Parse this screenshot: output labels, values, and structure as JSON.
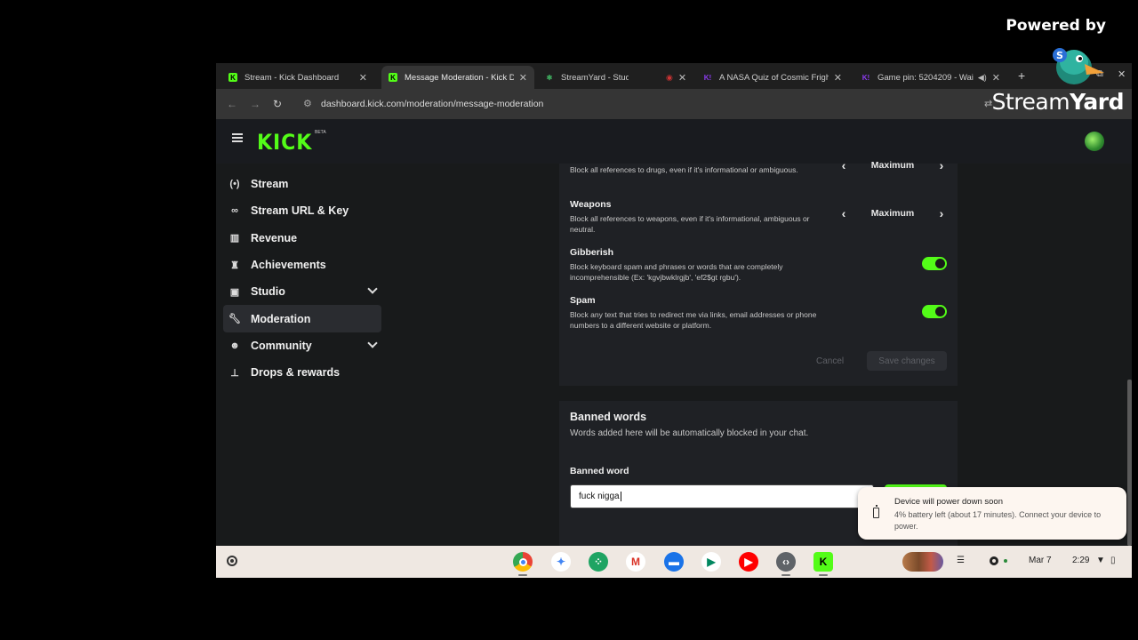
{
  "overlay": {
    "powered_by": "Powered by",
    "brand_prefix": "Stream",
    "brand_suffix": "Yard"
  },
  "browser": {
    "tabs": [
      {
        "title": "Stream - Kick Dashboard",
        "favicon": "kick-icon"
      },
      {
        "title": "Message Moderation - Kick Da",
        "favicon": "kick-icon",
        "active": true
      },
      {
        "title": "StreamYard - Studio",
        "favicon": "streamyard-icon"
      },
      {
        "title": "",
        "favicon": "record-icon"
      },
      {
        "title": "A NASA Quiz of Cosmic Fright",
        "favicon": "kahoot-icon"
      },
      {
        "title": "Game pin: 5204209 - Wai",
        "favicon": "kahoot-icon"
      }
    ],
    "url": "dashboard.kick.com/moderation/message-moderation"
  },
  "kick": {
    "logo": "KICK",
    "beta": "BETA",
    "sidebar": [
      {
        "label": "Stream",
        "icon": "broadcast-icon"
      },
      {
        "label": "Stream URL & Key",
        "icon": "link-icon"
      },
      {
        "label": "Revenue",
        "icon": "chart-icon"
      },
      {
        "label": "Achievements",
        "icon": "trophy-icon"
      },
      {
        "label": "Studio",
        "icon": "studio-icon",
        "expandable": true
      },
      {
        "label": "Moderation",
        "icon": "wrench-icon",
        "active": true
      },
      {
        "label": "Community",
        "icon": "people-icon",
        "expandable": true
      },
      {
        "label": "Drops & rewards",
        "icon": "drops-icon"
      }
    ],
    "rules": {
      "drugs": {
        "desc": "Block all references to drugs, even if it's informational or ambiguous.",
        "level": "Maximum"
      },
      "weapons": {
        "name": "Weapons",
        "desc": "Block all references to weapons, even if it's informational, ambiguous or neutral.",
        "level": "Maximum"
      },
      "gibberish": {
        "name": "Gibberish",
        "desc": "Block keyboard spam and phrases or words that are completely incomprehensible (Ex: 'kgvjbwklrgjb', 'ef2$gt rgbu').",
        "enabled": true
      },
      "spam": {
        "name": "Spam",
        "desc": "Block any text that tries to redirect me via links, email addresses or phone numbers to a different website or platform.",
        "enabled": true
      }
    },
    "buttons": {
      "cancel": "Cancel",
      "save": "Save changes"
    },
    "banned_words": {
      "title": "Banned words",
      "desc": "Words added here will be automatically blocked in your chat.",
      "label": "Banned word",
      "value": "fuck nigga"
    }
  },
  "notification": {
    "title": "Device will power down soon",
    "body": "4% battery left (about 17 minutes). Connect your device to power."
  },
  "shelf": {
    "date": "Mar 7",
    "time": "2:29"
  },
  "colors": {
    "accent": "#53fc18",
    "shelf": "#efe8e2"
  }
}
